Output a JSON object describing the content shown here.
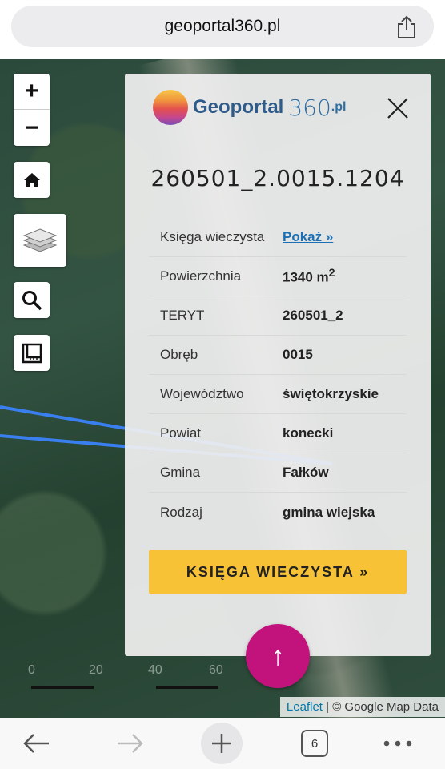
{
  "browser": {
    "url": "geoportal360.pl",
    "tab_count": "6"
  },
  "map": {
    "zoom_in": "+",
    "zoom_out": "−",
    "scale_labels": [
      "0",
      "20",
      "40",
      "60"
    ],
    "attribution_link": "Leaflet",
    "attribution_text": " | © Google Map Data"
  },
  "panel": {
    "logo_word": "Geoportal",
    "logo_num": "360",
    "logo_suffix": ".pl",
    "parcel_id": "260501_2.0015.1204",
    "rows": [
      {
        "label": "Księga wieczysta",
        "value": "Pokaż »"
      },
      {
        "label": "Powierzchnia",
        "value": "1340 m",
        "sup": "2"
      },
      {
        "label": "TERYT",
        "value": "260501_2"
      },
      {
        "label": "Obręb",
        "value": "0015"
      },
      {
        "label": "Województwo",
        "value": "świętokrzyskie"
      },
      {
        "label": "Powiat",
        "value": "konecki"
      },
      {
        "label": "Gmina",
        "value": "Fałków"
      },
      {
        "label": "Rodzaj",
        "value": "gmina wiejska"
      }
    ],
    "button_label": "KSIĘGA WIECZYSTA »",
    "up_arrow": "↑"
  },
  "colors": {
    "accent_yellow": "#f7c236",
    "fab_magenta": "#c2137d",
    "link_blue": "#1c6fb3",
    "line_blue": "#3a7ff0"
  },
  "icons": [
    "share-icon",
    "home-icon",
    "layers-icon",
    "search-icon",
    "ruler-icon",
    "close-icon",
    "back-arrow-icon",
    "forward-arrow-icon",
    "plus-icon",
    "more-icon"
  ]
}
